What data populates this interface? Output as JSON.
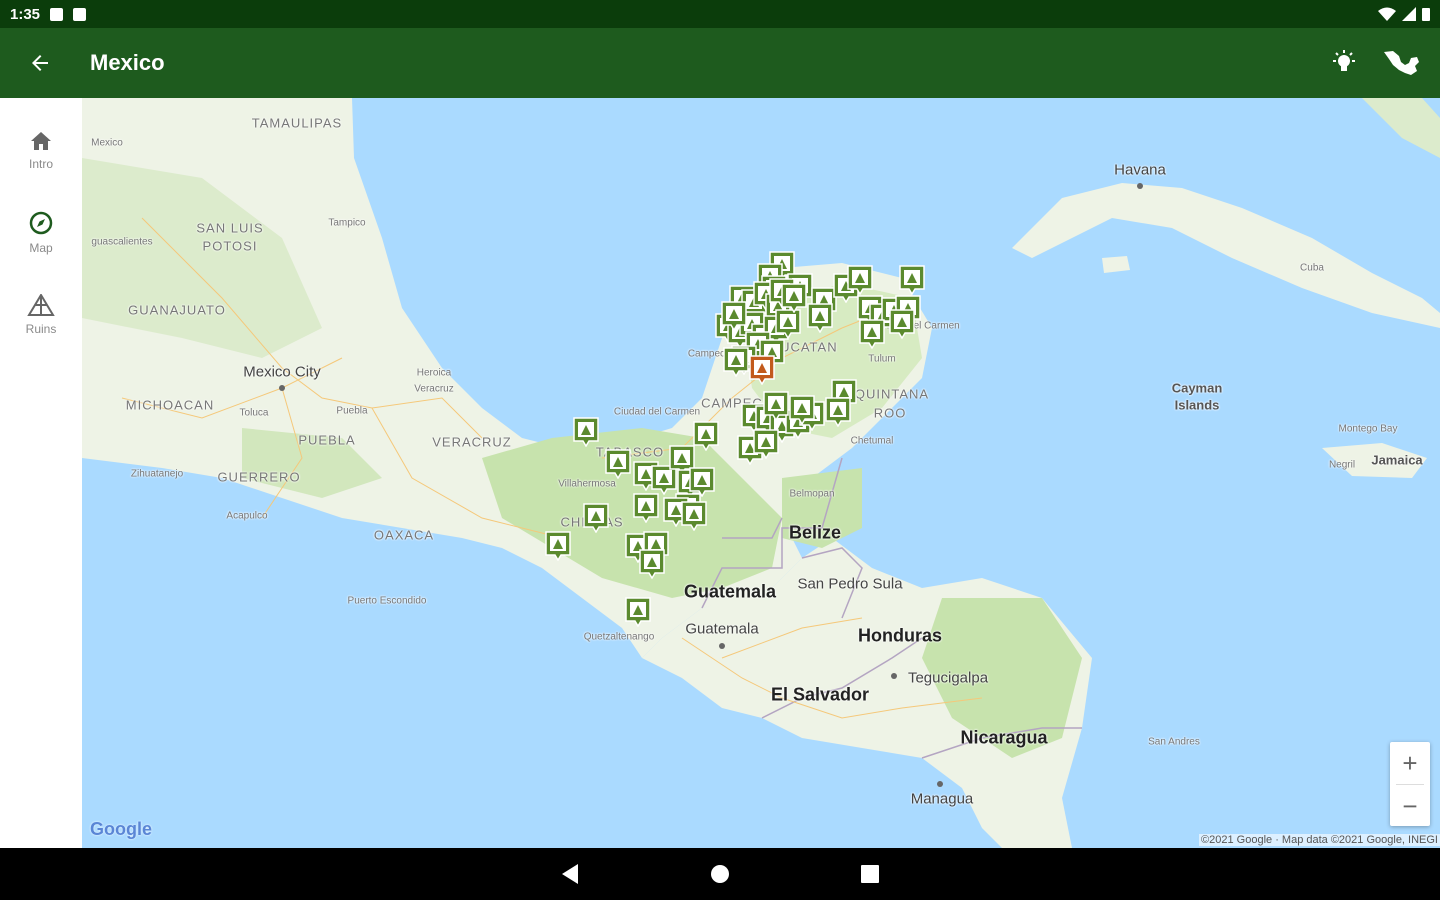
{
  "status": {
    "time": "1:35"
  },
  "appbar": {
    "title": "Mexico",
    "back_icon": "arrow-back-icon",
    "action_icons": [
      "lightbulb-icon",
      "mexico-map-icon"
    ]
  },
  "rail": {
    "items": [
      {
        "label": "Intro",
        "icon": "home-icon"
      },
      {
        "label": "Map",
        "icon": "compass-icon"
      },
      {
        "label": "Ruins",
        "icon": "pyramid-icon"
      }
    ]
  },
  "map": {
    "labels": {
      "tamaulipas": "TAMAULIPAS",
      "mexico_small": "Mexico",
      "san_luis": "SAN LUIS",
      "potosi": "POTOSI",
      "aguascalientes": "guascalientes",
      "tampico": "Tampico",
      "guanajuato": "GUANAJUATO",
      "mexico_city": "Mexico City",
      "michoacan": "MICHOACAN",
      "toluca": "Toluca",
      "puebla_city": "Puebla",
      "puebla": "PUEBLA",
      "heroica": "Heroica",
      "veracruz_city": "Veracruz",
      "veracruz": "VERACRUZ",
      "zihuatanejo": "Zihuatanejo",
      "guerrero": "GUERRERO",
      "acapulco": "Acapulco",
      "oaxaca": "OAXACA",
      "puerto_escondido": "Puerto Escondido",
      "tabasco": "TABASCO",
      "villahermosa": "Villahermosa",
      "ciudad_carmen": "Ciudad del Carmen",
      "campeche": "CAMPECHE",
      "campeche_city": "Campeche",
      "yucatan": "YUCATAN",
      "quintana": "QUINTANA",
      "roo": "ROO",
      "chetumal": "Chetumal",
      "tulum": "Tulum",
      "playa": "Playa del Carmen",
      "chiapas": "CHIAPAS",
      "belize": "Belize",
      "belmopan": "Belmopan",
      "guatemala": "Guatemala",
      "guatemala_city": "Guatemala",
      "quetzaltenango": "Quetzaltenango",
      "san_pedro_sula": "San Pedro Sula",
      "honduras": "Honduras",
      "tegucigalpa": "Tegucigalpa",
      "el_salvador": "El Salvador",
      "nicaragua": "Nicaragua",
      "managua": "Managua",
      "san_andres": "San Andres",
      "havana": "Havana",
      "cuba": "Cuba",
      "cayman_1": "Cayman",
      "cayman_2": "Islands",
      "montego": "Montego Bay",
      "jamaica": "Jamaica",
      "negril": "Negril"
    },
    "ruin_marker_count": 62,
    "highlighted_marker_color": "#c25a1c",
    "marker_color": "#5b8a2e",
    "zoom_in": "+",
    "zoom_out": "−",
    "google_logo": "Google",
    "attribution": "©2021 Google · Map data ©2021 Google, INEGI"
  },
  "colors": {
    "status_bar": "#0b3d0b",
    "app_bar": "#1e5b1e",
    "water": "#aadaff",
    "land": "#eef3e6",
    "forest": "#c7e3ad"
  }
}
